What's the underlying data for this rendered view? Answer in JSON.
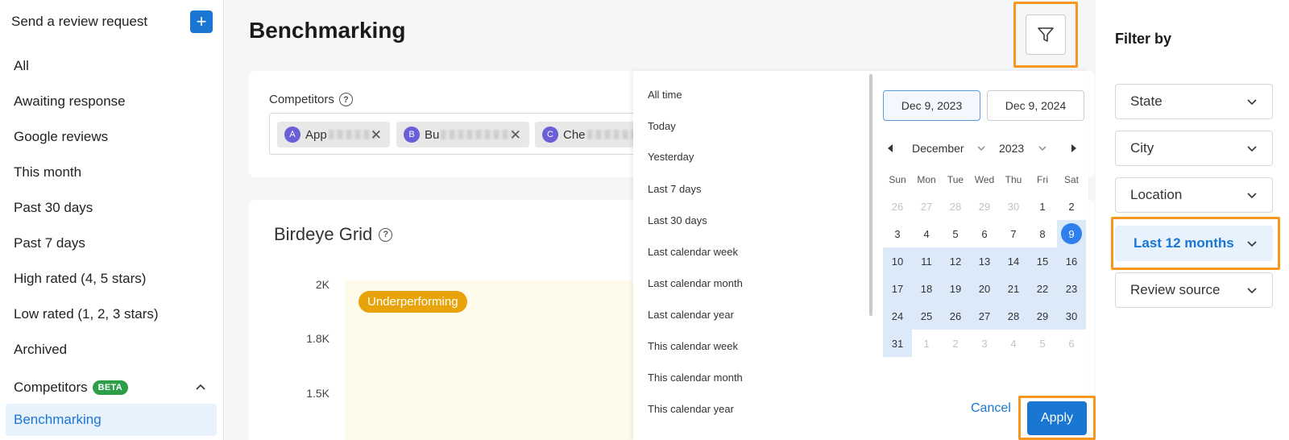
{
  "sidebar": {
    "header_title": "Send a review request",
    "items": [
      "All",
      "Awaiting response",
      "Google reviews",
      "This month",
      "Past 30 days",
      "Past 7 days",
      "High rated (4, 5 stars)",
      "Low rated (1, 2, 3 stars)",
      "Archived"
    ],
    "competitors_label": "Competitors",
    "beta_badge": "BETA",
    "active_item": "Benchmarking"
  },
  "main": {
    "title": "Benchmarking",
    "competitors_label": "Competitors",
    "chips": [
      {
        "avatar": "A",
        "name": "App"
      },
      {
        "avatar": "B",
        "name": "Bu"
      },
      {
        "avatar": "C",
        "name": "Che"
      }
    ],
    "grid_title": "Birdeye Grid",
    "y_ticks": [
      "2K",
      "1.8K",
      "1.5K"
    ],
    "underperforming_label": "Underperforming"
  },
  "date_picker": {
    "presets": [
      "All time",
      "Today",
      "Yesterday",
      "Last 7 days",
      "Last 30 days",
      "Last calendar week",
      "Last calendar month",
      "Last calendar year",
      "This calendar week",
      "This calendar month",
      "This calendar year"
    ],
    "start_date": "Dec 9, 2023",
    "end_date": "Dec 9, 2024",
    "month": "December",
    "year": "2023",
    "weekdays": [
      "Sun",
      "Mon",
      "Tue",
      "Wed",
      "Thu",
      "Fri",
      "Sat"
    ],
    "weeks": [
      [
        "26",
        "27",
        "28",
        "29",
        "30",
        "1",
        "2"
      ],
      [
        "3",
        "4",
        "5",
        "6",
        "7",
        "8",
        "9"
      ],
      [
        "10",
        "11",
        "12",
        "13",
        "14",
        "15",
        "16"
      ],
      [
        "17",
        "18",
        "19",
        "20",
        "21",
        "22",
        "23"
      ],
      [
        "24",
        "25",
        "26",
        "27",
        "28",
        "29",
        "30"
      ],
      [
        "31",
        "1",
        "2",
        "3",
        "4",
        "5",
        "6"
      ]
    ],
    "selected_day": "9",
    "cancel_label": "Cancel",
    "apply_label": "Apply"
  },
  "filter_panel": {
    "title": "Filter by",
    "fields": [
      "State",
      "City",
      "Location",
      "Last 12 months",
      "Review source"
    ],
    "highlighted_field": "Last 12 months"
  },
  "colors": {
    "primary": "#1976d2",
    "highlight_outline": "#f7971e",
    "beta": "#2e9e48",
    "underperforming": "#e8a30a"
  }
}
